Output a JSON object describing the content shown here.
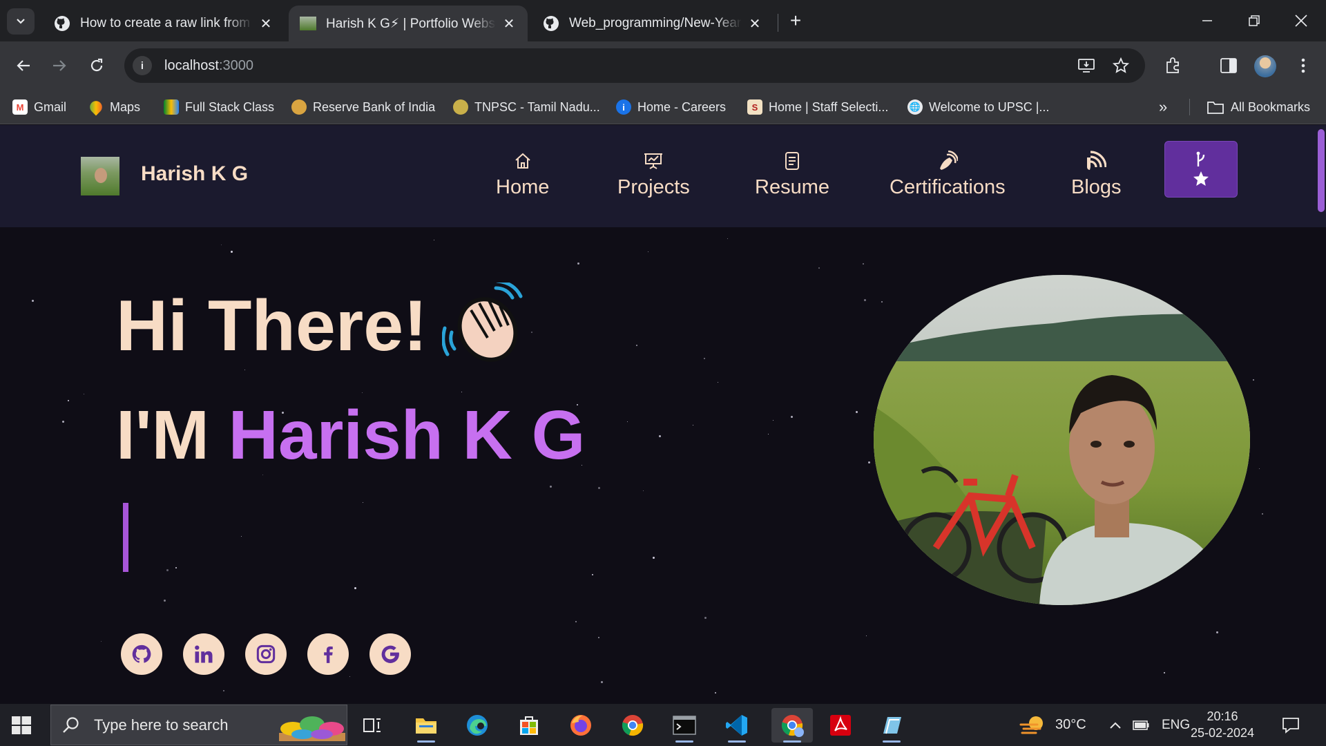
{
  "browser": {
    "tabs": [
      {
        "title": "How to create a raw link from G",
        "favicon": "github-icon",
        "active": false
      },
      {
        "title": "Harish K G⚡ | Portfolio Website",
        "favicon": "portfolio-favicon",
        "active": true
      },
      {
        "title": "Web_programming/New-Year-C",
        "favicon": "github-icon",
        "active": false
      }
    ],
    "url_host": "localhost",
    "url_port": ":3000",
    "bookmarks": [
      {
        "label": "Gmail"
      },
      {
        "label": "Maps"
      },
      {
        "label": "Full Stack  Class"
      },
      {
        "label": "Reserve Bank of India"
      },
      {
        "label": "TNPSC - Tamil Nadu..."
      },
      {
        "label": "Home - Careers"
      },
      {
        "label": "Home | Staff Selecti..."
      },
      {
        "label": "Welcome to UPSC |..."
      }
    ],
    "all_bookmarks_label": "All Bookmarks",
    "accent": "#35363a"
  },
  "site": {
    "brand": "Harish K G",
    "nav": [
      {
        "label": "Home",
        "icon": "home-icon"
      },
      {
        "label": "Projects",
        "icon": "projects-icon"
      },
      {
        "label": "Resume",
        "icon": "resume-icon"
      },
      {
        "label": "Certifications",
        "icon": "certifications-icon"
      },
      {
        "label": "Blogs",
        "icon": "blogs-icon"
      }
    ],
    "fork_icon": "git-fork-icon",
    "hero_greeting": "Hi There!",
    "hero_prefix": "I'M ",
    "hero_name": "Harish K G",
    "social": [
      "github-icon",
      "linkedin-icon",
      "instagram-icon",
      "facebook-icon",
      "google-icon"
    ],
    "colors": {
      "accent": "#c770f0",
      "cream": "#f7dcc5",
      "nav_bg": "#1b1a2e",
      "button": "#612f9d"
    }
  },
  "taskbar": {
    "search_placeholder": "Type here to search",
    "weather": "30°C",
    "language": "ENG",
    "time": "20:16",
    "date": "25-02-2024"
  }
}
